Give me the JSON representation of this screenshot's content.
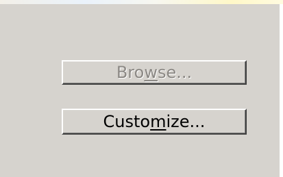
{
  "dialog": {
    "buttons": {
      "browse": {
        "pre": "Bro",
        "mnemonic": "w",
        "post": "se...",
        "enabled": false
      },
      "customize": {
        "pre": "Custo",
        "mnemonic": "m",
        "post": "ize...",
        "enabled": true
      }
    }
  },
  "colors": {
    "panel_background": "#d6d3ce",
    "disabled_text": "#8b8884",
    "enabled_text": "#000000"
  }
}
